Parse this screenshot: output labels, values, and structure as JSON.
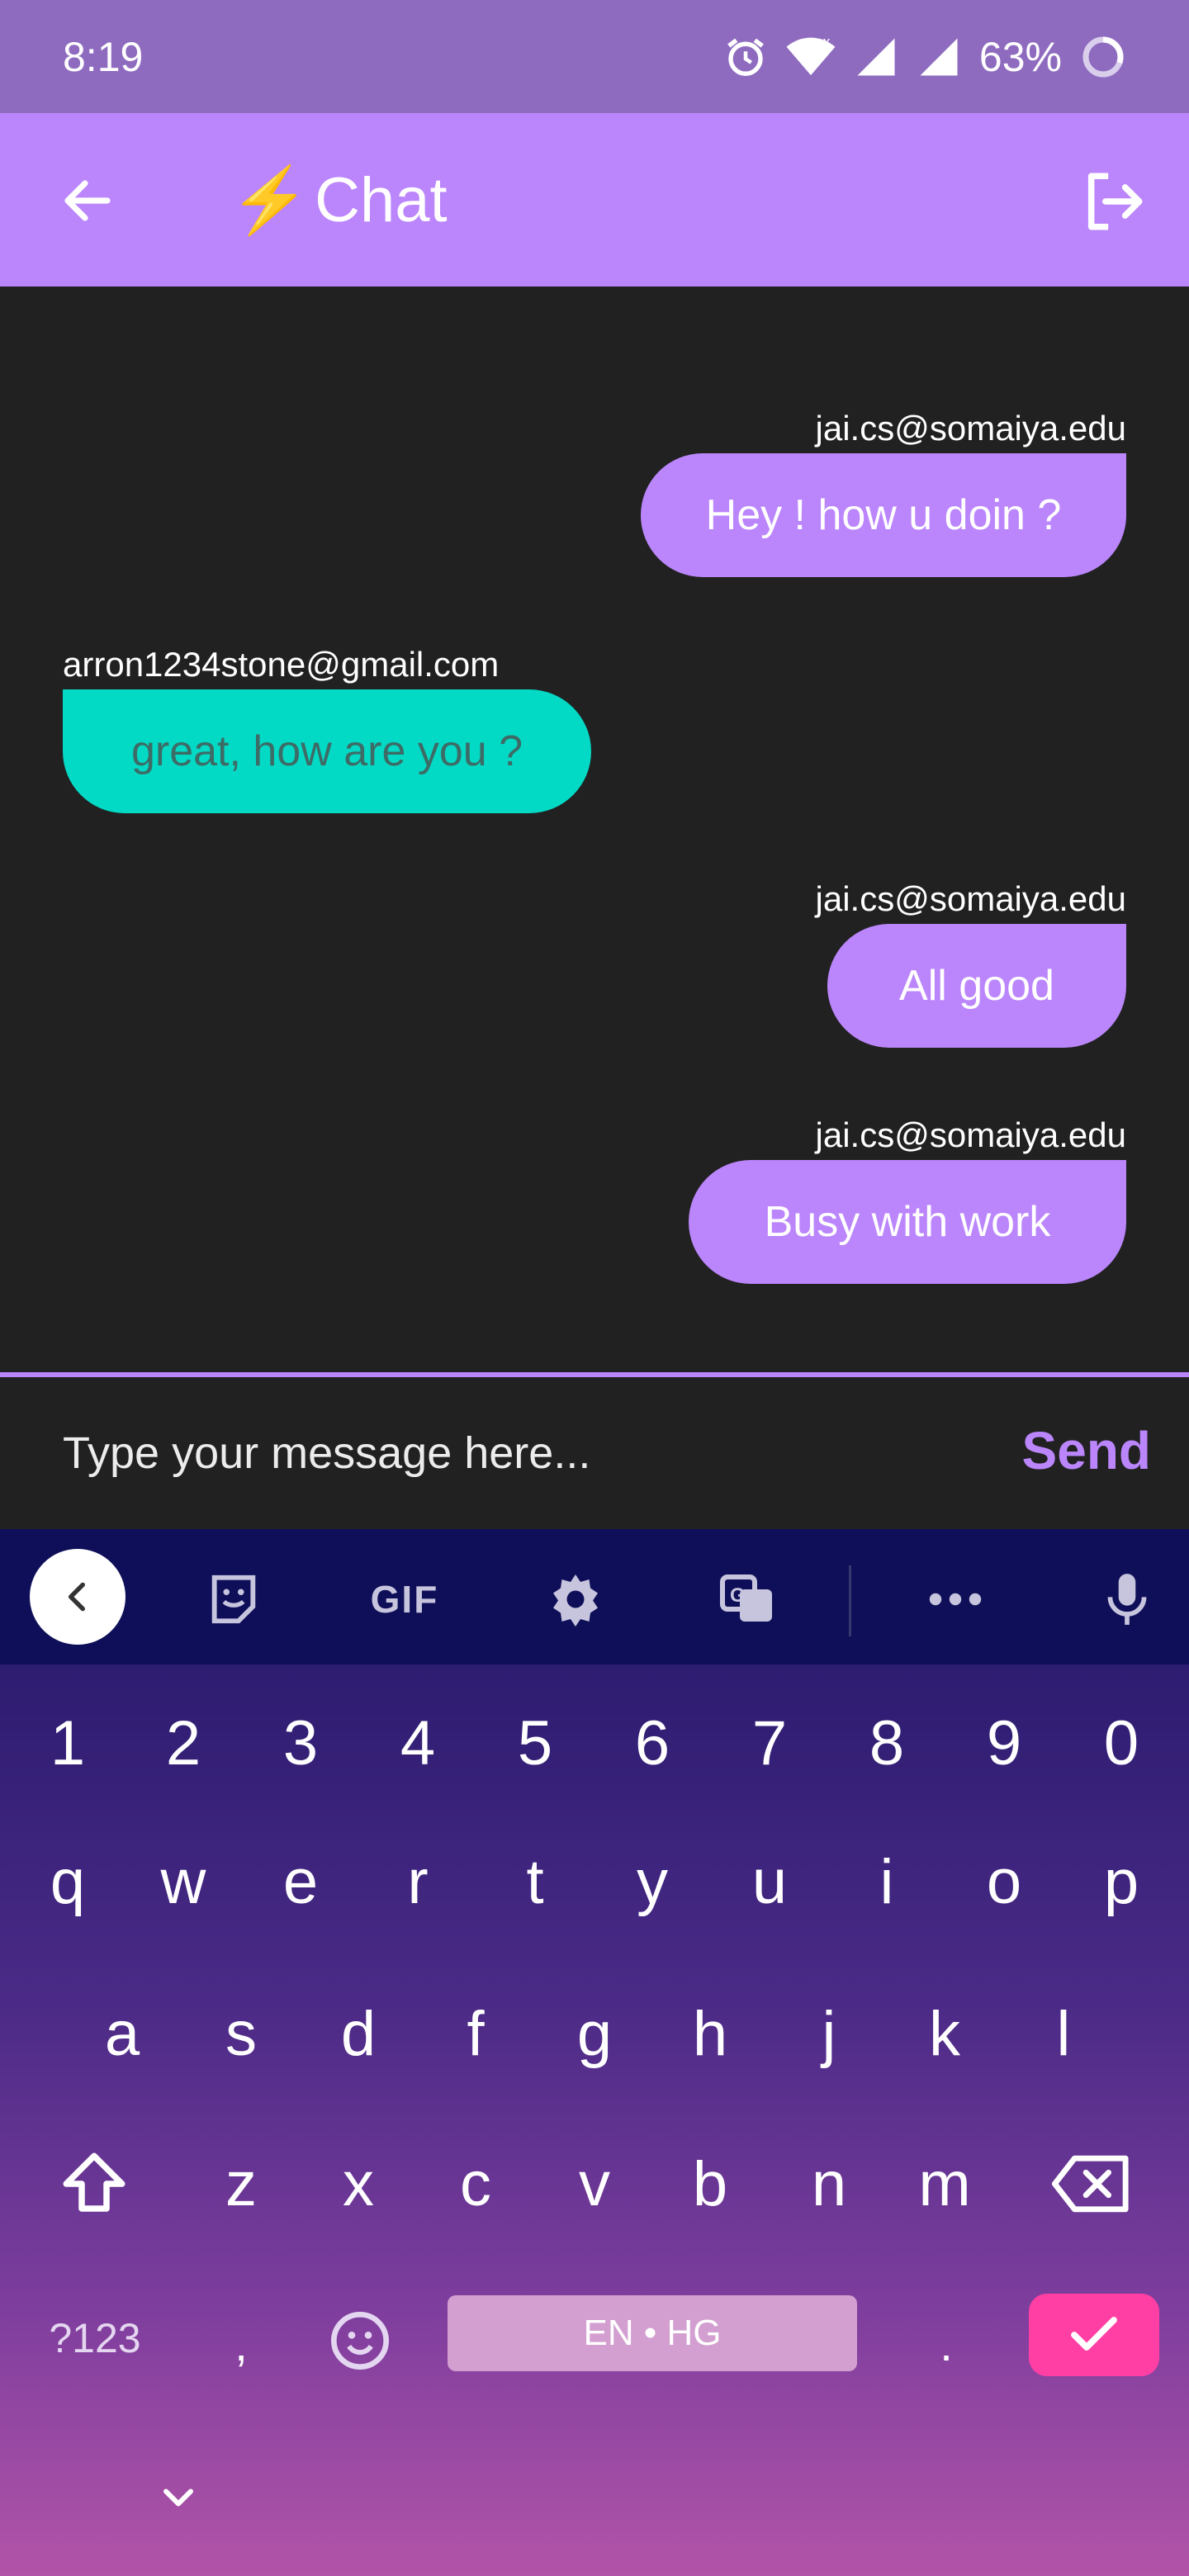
{
  "status_bar": {
    "time": "8:19",
    "battery": "63%",
    "icons": [
      "alarm-icon",
      "wifi-icon",
      "signal-icon",
      "signal-icon",
      "battery-icon"
    ]
  },
  "app_bar": {
    "title_icon": "⚡",
    "title": "Chat",
    "back_icon": "arrow-left-icon",
    "logout_icon": "logout-icon",
    "color": "#bb86fc"
  },
  "messages": [
    {
      "sender": "jai.cs@somaiya.edu",
      "text": "Hey ! how u doin ?",
      "mine": true
    },
    {
      "sender": "arron1234stone@gmail.com",
      "text": "great, how are you ?",
      "mine": false
    },
    {
      "sender": "jai.cs@somaiya.edu",
      "text": "All good",
      "mine": true
    },
    {
      "sender": "jai.cs@somaiya.edu",
      "text": "Busy with work",
      "mine": true
    }
  ],
  "input": {
    "placeholder": "Type your message here...",
    "value": "",
    "send_label": "Send"
  },
  "keyboard": {
    "toolbar": {
      "gif_label": "GIF",
      "icons": [
        "chevron-left-icon",
        "sticker-icon",
        "gif-icon",
        "settings-icon",
        "translate-icon",
        "more-icon",
        "mic-icon"
      ]
    },
    "number_row": [
      "1",
      "2",
      "3",
      "4",
      "5",
      "6",
      "7",
      "8",
      "9",
      "0"
    ],
    "row1": [
      "q",
      "w",
      "e",
      "r",
      "t",
      "y",
      "u",
      "i",
      "o",
      "p"
    ],
    "row2": [
      "a",
      "s",
      "d",
      "f",
      "g",
      "h",
      "j",
      "k",
      "l"
    ],
    "row3": [
      "z",
      "x",
      "c",
      "v",
      "b",
      "n",
      "m"
    ],
    "symbols_label": "?123",
    "comma": ",",
    "period": ".",
    "space_label": "EN • HG"
  },
  "colors": {
    "accent": "#bb86fc",
    "teal": "#03dac5",
    "background": "#212121",
    "enter": "#ff3fa4"
  }
}
